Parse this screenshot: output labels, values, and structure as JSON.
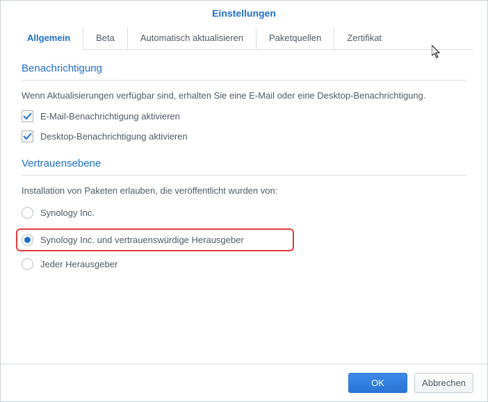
{
  "header": {
    "title": "Einstellungen"
  },
  "tabs": {
    "items": [
      {
        "label": "Allgemein",
        "active": true
      },
      {
        "label": "Beta",
        "active": false
      },
      {
        "label": "Automatisch aktualisieren",
        "active": false
      },
      {
        "label": "Paketquellen",
        "active": false
      },
      {
        "label": "Zertifikat",
        "active": false
      }
    ]
  },
  "notification": {
    "title": "Benachrichtigung",
    "description": "Wenn Aktualisierungen verfügbar sind, erhalten Sie eine E-Mail oder eine Desktop-Benachrichtigung.",
    "email_label": "E-Mail-Benachrichtigung aktivieren",
    "email_checked": true,
    "desktop_label": "Desktop-Benachrichtigung aktivieren",
    "desktop_checked": true
  },
  "trust": {
    "title": "Vertrauensebene",
    "description": "Installation von Paketen erlauben, die veröffentlicht wurden von:",
    "options": [
      {
        "label": "Synology Inc.",
        "selected": false
      },
      {
        "label": "Synology Inc. und vertrauenswürdige Herausgeber",
        "selected": true
      },
      {
        "label": "Jeder Herausgeber",
        "selected": false
      }
    ]
  },
  "footer": {
    "ok": "OK",
    "cancel": "Abbrechen"
  }
}
